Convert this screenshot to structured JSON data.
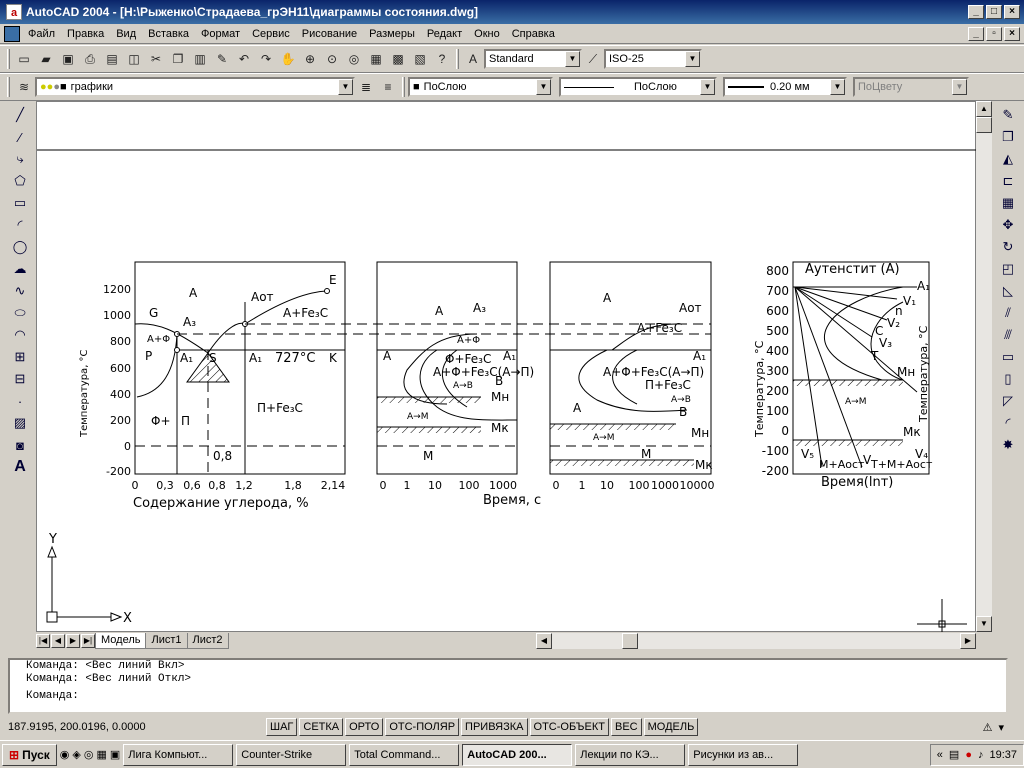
{
  "window": {
    "title": "AutoCAD 2004 - [H:\\Рыженко\\Страдаева_грЭН11\\диаграммы состояния.dwg]",
    "app_letter": "a"
  },
  "menu": [
    "Файл",
    "Правка",
    "Вид",
    "Вставка",
    "Формат",
    "Сервис",
    "Рисование",
    "Размеры",
    "Редакт",
    "Окно",
    "Справка"
  ],
  "toolbar": {
    "text_style": "Standard",
    "dim_style": "ISO-25",
    "layer": "графики",
    "color": "ПоСлою",
    "linetype": "ПоСлою",
    "lineweight": "0.20 мм",
    "plotstyle": "ПоЦвету"
  },
  "diagram1": {
    "y_ticks": [
      "1200",
      "1000",
      "800",
      "600",
      "400",
      "200",
      "0",
      "-200"
    ],
    "x_ticks": [
      "0",
      "0,3",
      "0,6",
      "0,8",
      "1,2",
      "1,8",
      "2,14"
    ],
    "ylabel": "Температура, °С",
    "xlabel": "Содержание углерода, %",
    "labels": {
      "A": "A",
      "E": "E",
      "G": "G",
      "Aот": "Aот",
      "AFe3C": "A+Fe₃C",
      "A3": "A₃",
      "AF": "A+Φ",
      "P": "P",
      "A1": "A₁",
      "S": "S",
      "A1b": "A₁",
      "t727": "727°С",
      "K": "K",
      "FP": "Φ+",
      "Pi": "П",
      "PFe3C": "П+Fe₃C",
      "c08": "0,8"
    }
  },
  "diagram2": {
    "x_ticks": [
      "0",
      "1",
      "10",
      "100",
      "1000"
    ],
    "xlabel": "Время, с",
    "labels": {
      "A": "A",
      "A3": "A₃",
      "AF": "A+Φ",
      "FFe3C": "Φ+Fe₃C",
      "A1": "A₁",
      "A2": "A",
      "AFFe3C": "A+Φ+Fe₃C(A→П)",
      "AB": "A→B",
      "B": "B",
      "Mn": "Mн",
      "AM": "A→M",
      "Mk": "Mк",
      "M": "M"
    }
  },
  "diagram3": {
    "x_ticks": [
      "0",
      "1",
      "10",
      "100",
      "1000",
      "10000"
    ],
    "labels": {
      "A": "A",
      "Aот": "Aот",
      "AFe3C": "A+Fe₃C",
      "A1": "A₁",
      "AFFe3C": "A+Φ+Fe₃C(A→П)",
      "PFe3C": "П+Fe₃C",
      "A2": "A",
      "AB": "A→B",
      "B": "B",
      "Mn": "Mн",
      "AM": "A→M",
      "M": "M",
      "Mk": "Mк"
    }
  },
  "diagram4": {
    "y_ticks": [
      "800",
      "700",
      "600",
      "500",
      "400",
      "300",
      "200",
      "100",
      "0",
      "-100",
      "-200"
    ],
    "ylabel": "Температура, °С",
    "ylabel_right": "Температура, °С",
    "xlabel": "Время(lnт)",
    "labels": {
      "aust": "Аутенстит (A)",
      "A1": "A₁",
      "V1": "V₁",
      "n": "n",
      "V2": "V₂",
      "C": "C",
      "V3": "V₃",
      "T": "T",
      "Mn": "Mн",
      "AM": "A→M",
      "Mk": "Mк",
      "V5": "V₅",
      "MAost": "M+Aост",
      "V4L": "V",
      "TMAost": "T+M+Aост",
      "V4": "V₄"
    }
  },
  "ucs": {
    "y": "Y",
    "x": "X"
  },
  "layout_tabs": [
    "Модель",
    "Лист1",
    "Лист2"
  ],
  "command_lines": [
    "Команда:  <Вес линий Вкл>",
    "Команда:  <Вес линий Откл>",
    "Команда:"
  ],
  "status": {
    "coords": "187.9195, 200.0196, 0.0000",
    "toggles": [
      "ШАГ",
      "СЕТКА",
      "ОРТО",
      "ОТС-ПОЛЯР",
      "ПРИВЯЗКА",
      "ОТС-ОБЪЕКТ",
      "ВЕС",
      "МОДЕЛЬ"
    ]
  },
  "taskbar": {
    "start": "Пуск",
    "tasks": [
      "Лига Компьют...",
      "Counter-Strike",
      "Total Command...",
      "AutoCAD 200...",
      "Лекции по КЭ...",
      "Рисунки из ав..."
    ],
    "active_task": 3,
    "clock": "19:37",
    "tray_chevron": "«"
  }
}
